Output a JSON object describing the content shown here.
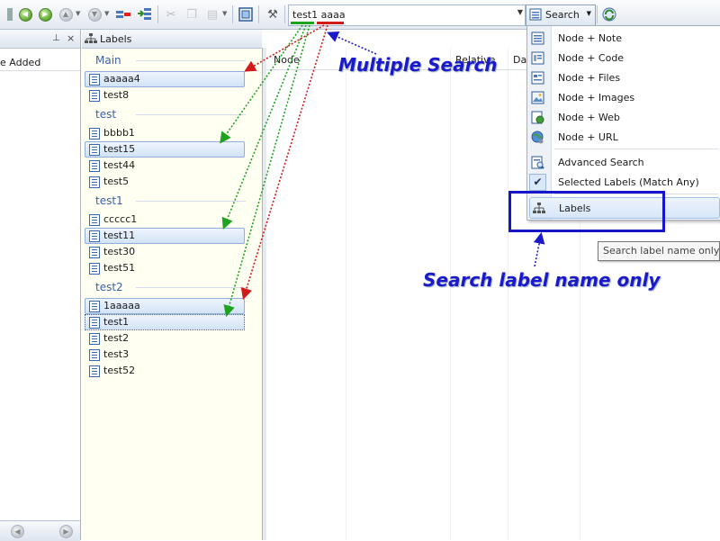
{
  "toolbar": {
    "search_text_green": "test1",
    "search_text_red": "aaaa",
    "search_button": "Search"
  },
  "left_pane": {
    "column_header": "e Added"
  },
  "labels_pane": {
    "title": "Labels",
    "groups": [
      {
        "name": "Main",
        "items": [
          {
            "label": "aaaaa4"
          },
          {
            "label": "test8"
          }
        ]
      },
      {
        "name": "test",
        "items": [
          {
            "label": "bbbb1"
          },
          {
            "label": "test15"
          },
          {
            "label": "test44"
          },
          {
            "label": "test5"
          }
        ]
      },
      {
        "name": "test1",
        "items": [
          {
            "label": "ccccc1"
          },
          {
            "label": "test11"
          },
          {
            "label": "test30"
          },
          {
            "label": "test51"
          }
        ]
      },
      {
        "name": "test2",
        "items": [
          {
            "label": "1aaaaa"
          },
          {
            "label": "test1"
          },
          {
            "label": "test2"
          },
          {
            "label": "test3"
          },
          {
            "label": "test52"
          }
        ]
      }
    ]
  },
  "grid": {
    "columns": [
      "Node",
      "Relative",
      "Da"
    ]
  },
  "search_menu": {
    "items": [
      {
        "label": "Node + Note",
        "icon": "note-icon"
      },
      {
        "label": "Node + Code",
        "icon": "code-icon"
      },
      {
        "label": "Node + Files",
        "icon": "files-icon"
      },
      {
        "label": "Node + Images",
        "icon": "image-icon"
      },
      {
        "label": "Node + Web",
        "icon": "web-icon"
      },
      {
        "label": "Node + URL",
        "icon": "url-icon"
      },
      {
        "label": "Advanced Search",
        "icon": "advanced-search-icon"
      },
      {
        "label": "Selected Labels (Match Any)",
        "icon": "check-icon",
        "checked": true
      },
      {
        "label": "Labels",
        "icon": "labels-icon",
        "highlighted": true
      }
    ]
  },
  "tooltip": "Search label name only",
  "annotations": {
    "multiple_search": "Multiple Search",
    "label_only": "Search label name only"
  },
  "colors": {
    "annotation": "#1a1acb",
    "match_green": "#1ea31e",
    "match_red": "#d11a1a"
  }
}
